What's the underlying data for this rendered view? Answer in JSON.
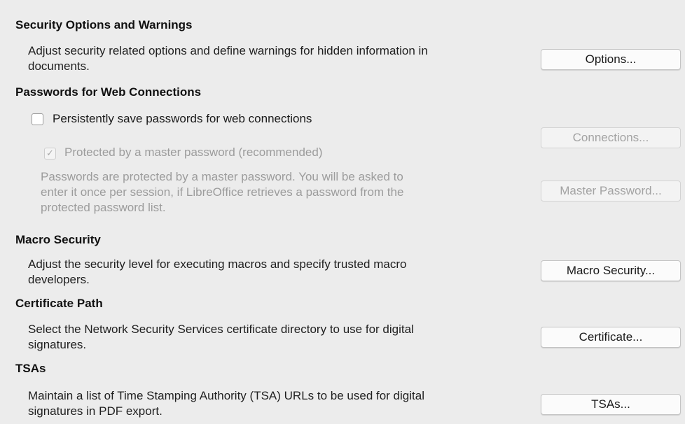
{
  "sections": {
    "security_options": {
      "heading": "Security Options and Warnings",
      "desc_line1": "Adjust security related options and define warnings for hidden information in",
      "desc_line2": "documents.",
      "button_label": "Options..."
    },
    "passwords": {
      "heading": "Passwords for Web Connections",
      "persist_label": "Persistently save passwords for web connections",
      "persist_checked": false,
      "connections_button_label": "Connections...",
      "master_label": "Protected by a master password (recommended)",
      "master_checked": true,
      "desc_line1": "Passwords are protected by a master password. You will be asked to",
      "desc_line2": "enter it once per session, if LibreOffice retrieves a password from the",
      "desc_line3": "protected password list.",
      "master_button_label": "Master Password..."
    },
    "macro_security": {
      "heading": "Macro Security",
      "desc_line1": "Adjust the security level for executing macros and specify trusted macro",
      "desc_line2": "developers.",
      "button_label": "Macro Security..."
    },
    "certificate_path": {
      "heading": "Certificate Path",
      "desc_line1": "Select the Network Security Services certificate directory to use for digital",
      "desc_line2": "signatures.",
      "button_label": "Certificate..."
    },
    "tsas": {
      "heading": "TSAs",
      "desc_line1": "Maintain a list of Time Stamping Authority (TSA) URLs to be used for digital",
      "desc_line2": "signatures in PDF export.",
      "button_label": "TSAs..."
    }
  },
  "colors": {
    "background": "#ececec",
    "text": "#1a1a1a",
    "disabled_text": "#9c9c9c"
  }
}
